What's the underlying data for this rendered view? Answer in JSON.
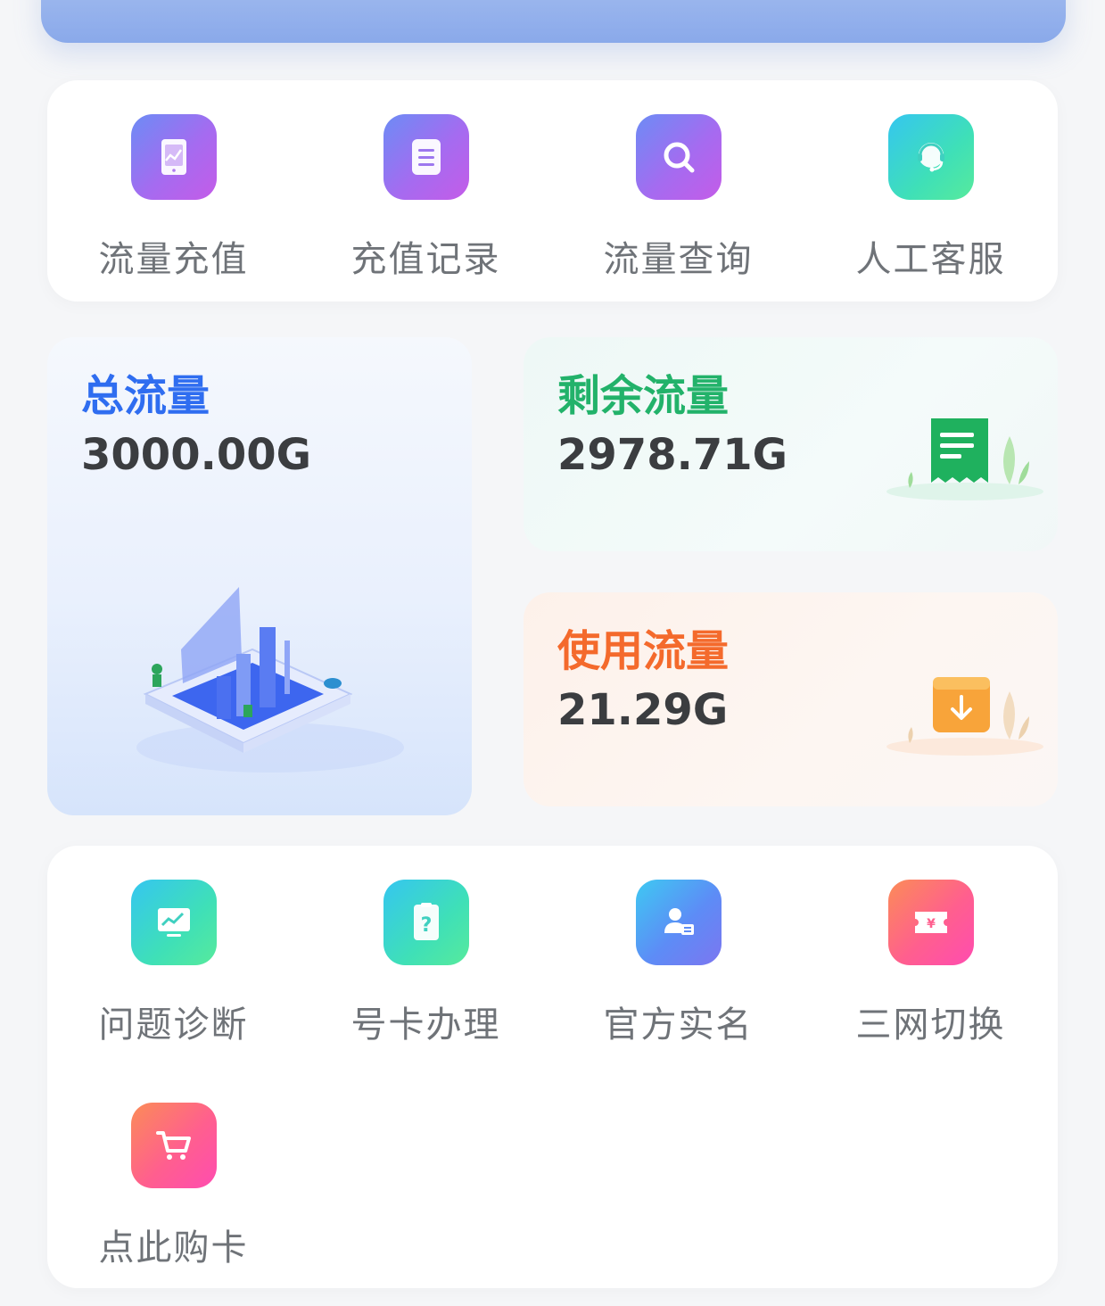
{
  "quick_actions": [
    {
      "label": "流量充值",
      "icon": "recharge-chart-icon"
    },
    {
      "label": "充值记录",
      "icon": "document-list-icon"
    },
    {
      "label": "流量查询",
      "icon": "search-icon"
    },
    {
      "label": "人工客服",
      "icon": "headset-agent-icon"
    }
  ],
  "stats": {
    "total": {
      "title": "总流量",
      "value": "3000.00G"
    },
    "remaining": {
      "title": "剩余流量",
      "value": "2978.71G"
    },
    "used": {
      "title": "使用流量",
      "value": "21.29G"
    }
  },
  "tools": [
    {
      "label": "问题诊断",
      "icon": "monitor-chart-icon"
    },
    {
      "label": "号卡办理",
      "icon": "question-card-icon"
    },
    {
      "label": "官方实名",
      "icon": "id-verify-icon"
    },
    {
      "label": "三网切换",
      "icon": "yuan-ticket-icon"
    },
    {
      "label": "点此购卡",
      "icon": "shopping-cart-icon"
    }
  ],
  "colors": {
    "total_title": "#2f6df0",
    "remaining_title": "#22b26a",
    "used_title": "#f46a2c"
  }
}
